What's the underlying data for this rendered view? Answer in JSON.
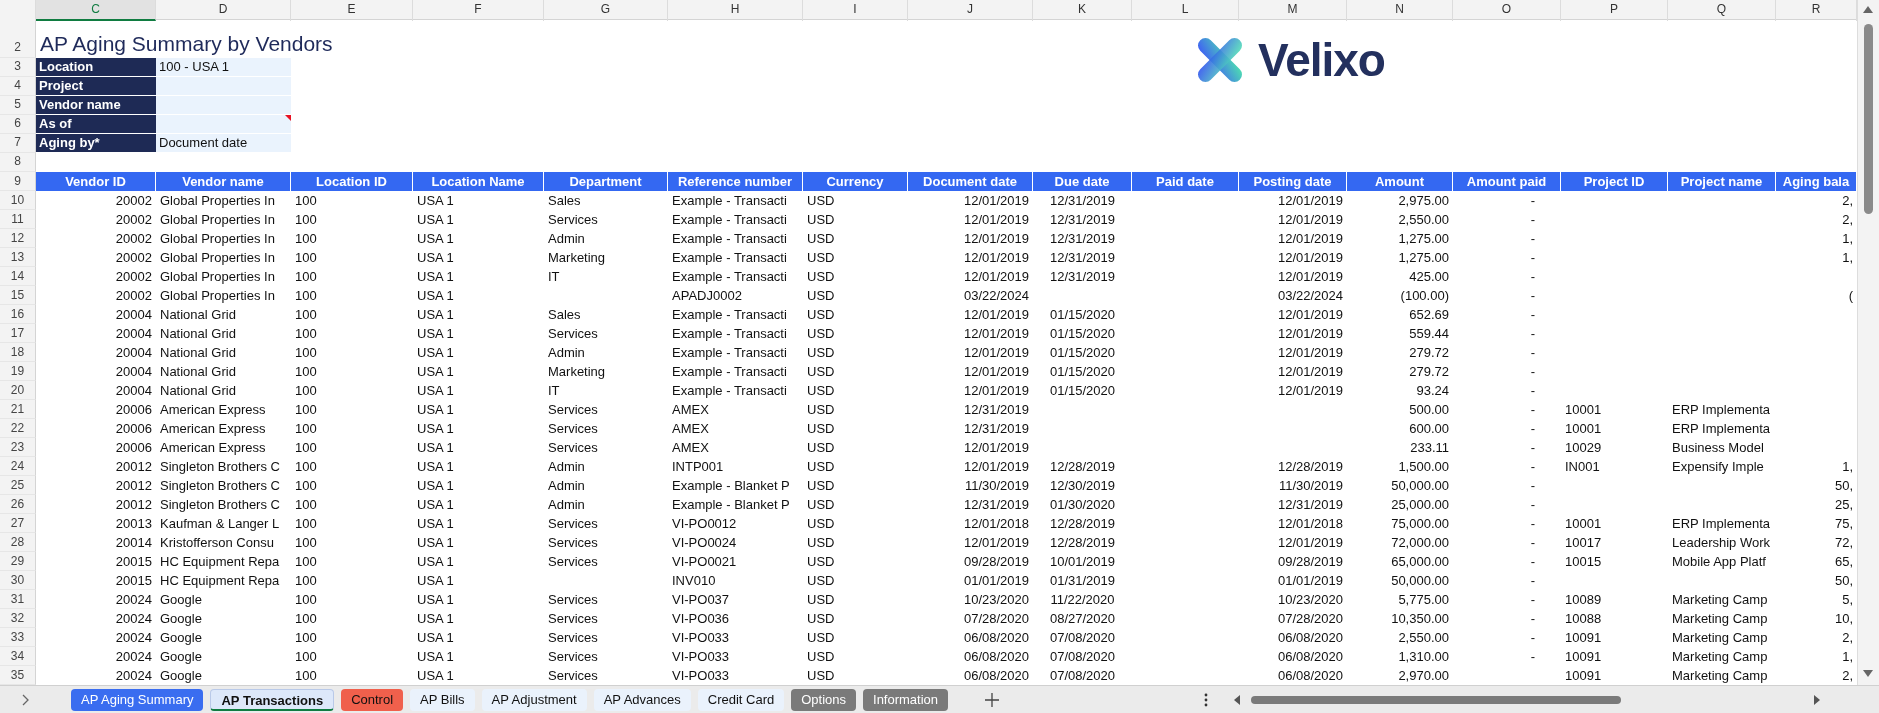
{
  "column_letters": [
    {
      "label": "C",
      "selected": true
    },
    {
      "label": "D",
      "selected": false
    },
    {
      "label": "E",
      "selected": false
    },
    {
      "label": "F",
      "selected": false
    },
    {
      "label": "G",
      "selected": false
    },
    {
      "label": "H",
      "selected": false
    },
    {
      "label": "I",
      "selected": false
    },
    {
      "label": "J",
      "selected": false
    },
    {
      "label": "K",
      "selected": false
    },
    {
      "label": "L",
      "selected": false
    },
    {
      "label": "M",
      "selected": false
    },
    {
      "label": "N",
      "selected": false
    },
    {
      "label": "O",
      "selected": false
    },
    {
      "label": "P",
      "selected": false
    },
    {
      "label": "Q",
      "selected": false
    },
    {
      "label": "R",
      "selected": false
    }
  ],
  "top_row_numbers": [
    "2",
    "3",
    "4",
    "5",
    "6",
    "7",
    "8"
  ],
  "title": "AP Aging Summary by Vendors",
  "parameters": [
    {
      "label": "Location",
      "value": "100 - USA 1",
      "comment": false
    },
    {
      "label": "Project",
      "comment": false
    },
    {
      "label": "Vendor name",
      "comment": false
    },
    {
      "label": "As of",
      "comment": true
    },
    {
      "label": "Aging by*",
      "value": "Document date",
      "comment": false
    }
  ],
  "logo": {
    "text": "Velixo"
  },
  "table": {
    "header_row_number": "9",
    "columns": [
      "Vendor ID",
      "Vendor name",
      "Location ID",
      "Location Name",
      "Department",
      "Reference number",
      "Currency",
      "Document date",
      "Due date",
      "Paid date",
      "Posting date",
      "Amount",
      "Amount paid",
      "Project ID",
      "Project name",
      "Aging bala"
    ],
    "rows": [
      {
        "number": "10",
        "cells": [
          "20002",
          "Global Properties In",
          "100",
          "USA 1",
          "Sales",
          "Example - Transacti",
          "USD",
          "12/01/2019",
          "12/31/2019",
          null,
          "12/01/2019",
          "2,975.00",
          "-",
          null,
          null,
          "2,"
        ]
      },
      {
        "number": "11",
        "cells": [
          "20002",
          "Global Properties In",
          "100",
          "USA 1",
          "Services",
          "Example - Transacti",
          "USD",
          "12/01/2019",
          "12/31/2019",
          null,
          "12/01/2019",
          "2,550.00",
          "-",
          null,
          null,
          "2,"
        ]
      },
      {
        "number": "12",
        "cells": [
          "20002",
          "Global Properties In",
          "100",
          "USA 1",
          "Admin",
          "Example - Transacti",
          "USD",
          "12/01/2019",
          "12/31/2019",
          null,
          "12/01/2019",
          "1,275.00",
          "-",
          null,
          null,
          "1,"
        ]
      },
      {
        "number": "13",
        "cells": [
          "20002",
          "Global Properties In",
          "100",
          "USA 1",
          "Marketing",
          "Example - Transacti",
          "USD",
          "12/01/2019",
          "12/31/2019",
          null,
          "12/01/2019",
          "1,275.00",
          "-",
          null,
          null,
          "1,"
        ]
      },
      {
        "number": "14",
        "cells": [
          "20002",
          "Global Properties In",
          "100",
          "USA 1",
          "IT",
          "Example - Transacti",
          "USD",
          "12/01/2019",
          "12/31/2019",
          null,
          "12/01/2019",
          "425.00",
          "-",
          null,
          null,
          null
        ]
      },
      {
        "number": "15",
        "cells": [
          "20002",
          "Global Properties In",
          "100",
          "USA 1",
          null,
          "APADJ0002",
          "USD",
          "03/22/2024",
          null,
          null,
          "03/22/2024",
          "(100.00)",
          "-",
          null,
          null,
          "("
        ]
      },
      {
        "number": "16",
        "cells": [
          "20004",
          "National Grid",
          "100",
          "USA 1",
          "Sales",
          "Example - Transacti",
          "USD",
          "12/01/2019",
          "01/15/2020",
          null,
          "12/01/2019",
          "652.69",
          "-",
          null,
          null,
          null
        ]
      },
      {
        "number": "17",
        "cells": [
          "20004",
          "National Grid",
          "100",
          "USA 1",
          "Services",
          "Example - Transacti",
          "USD",
          "12/01/2019",
          "01/15/2020",
          null,
          "12/01/2019",
          "559.44",
          "-",
          null,
          null,
          null
        ]
      },
      {
        "number": "18",
        "cells": [
          "20004",
          "National Grid",
          "100",
          "USA 1",
          "Admin",
          "Example - Transacti",
          "USD",
          "12/01/2019",
          "01/15/2020",
          null,
          "12/01/2019",
          "279.72",
          "-",
          null,
          null,
          null
        ]
      },
      {
        "number": "19",
        "cells": [
          "20004",
          "National Grid",
          "100",
          "USA 1",
          "Marketing",
          "Example - Transacti",
          "USD",
          "12/01/2019",
          "01/15/2020",
          null,
          "12/01/2019",
          "279.72",
          "-",
          null,
          null,
          null
        ]
      },
      {
        "number": "20",
        "cells": [
          "20004",
          "National Grid",
          "100",
          "USA 1",
          "IT",
          "Example - Transacti",
          "USD",
          "12/01/2019",
          "01/15/2020",
          null,
          "12/01/2019",
          "93.24",
          "-",
          null,
          null,
          null
        ]
      },
      {
        "number": "21",
        "cells": [
          "20006",
          "American Express",
          "100",
          "USA 1",
          "Services",
          "AMEX",
          "USD",
          "12/31/2019",
          null,
          null,
          null,
          "500.00",
          "-",
          "10001",
          "ERP Implementa",
          null
        ]
      },
      {
        "number": "22",
        "cells": [
          "20006",
          "American Express",
          "100",
          "USA 1",
          "Services",
          "AMEX",
          "USD",
          "12/31/2019",
          null,
          null,
          null,
          "600.00",
          "-",
          "10001",
          "ERP Implementa",
          null
        ]
      },
      {
        "number": "23",
        "cells": [
          "20006",
          "American Express",
          "100",
          "USA 1",
          "Services",
          "AMEX",
          "USD",
          "12/01/2019",
          null,
          null,
          null,
          "233.11",
          "-",
          "10029",
          "Business Model",
          null
        ]
      },
      {
        "number": "24",
        "cells": [
          "20012",
          "Singleton Brothers C",
          "100",
          "USA 1",
          "Admin",
          "INTP001",
          "USD",
          "12/01/2019",
          "12/28/2019",
          null,
          "12/28/2019",
          "1,500.00",
          "-",
          "IN001",
          "Expensify Imple",
          "1,"
        ]
      },
      {
        "number": "25",
        "cells": [
          "20012",
          "Singleton Brothers C",
          "100",
          "USA 1",
          "Admin",
          "Example - Blanket P",
          "USD",
          "11/30/2019",
          "12/30/2019",
          null,
          "11/30/2019",
          "50,000.00",
          "-",
          null,
          null,
          "50,"
        ]
      },
      {
        "number": "26",
        "cells": [
          "20012",
          "Singleton Brothers C",
          "100",
          "USA 1",
          "Admin",
          "Example - Blanket P",
          "USD",
          "12/31/2019",
          "01/30/2020",
          null,
          "12/31/2019",
          "25,000.00",
          "-",
          null,
          null,
          "25,"
        ]
      },
      {
        "number": "27",
        "cells": [
          "20013",
          "Kaufman & Langer L",
          "100",
          "USA 1",
          "Services",
          "VI-PO0012",
          "USD",
          "12/01/2018",
          "12/28/2019",
          null,
          "12/01/2018",
          "75,000.00",
          "-",
          "10001",
          "ERP Implementa",
          "75,"
        ]
      },
      {
        "number": "28",
        "cells": [
          "20014",
          "Kristofferson Consu",
          "100",
          "USA 1",
          "Services",
          "VI-PO0024",
          "USD",
          "12/01/2019",
          "12/28/2019",
          null,
          "12/01/2019",
          "72,000.00",
          "-",
          "10017",
          "Leadership Work",
          "72,"
        ]
      },
      {
        "number": "29",
        "cells": [
          "20015",
          "HC Equipment Repa",
          "100",
          "USA 1",
          "Services",
          "VI-PO0021",
          "USD",
          "09/28/2019",
          "10/01/2019",
          null,
          "09/28/2019",
          "65,000.00",
          "-",
          "10015",
          "Mobile App Platf",
          "65,"
        ]
      },
      {
        "number": "30",
        "cells": [
          "20015",
          "HC Equipment Repa",
          "100",
          "USA 1",
          null,
          "INV010",
          "USD",
          "01/01/2019",
          "01/31/2019",
          null,
          "01/01/2019",
          "50,000.00",
          "-",
          null,
          null,
          "50,"
        ]
      },
      {
        "number": "31",
        "cells": [
          "20024",
          "Google",
          "100",
          "USA 1",
          "Services",
          "VI-PO037",
          "USD",
          "10/23/2020",
          "11/22/2020",
          null,
          "10/23/2020",
          "5,775.00",
          "-",
          "10089",
          "Marketing Camp",
          "5,"
        ]
      },
      {
        "number": "32",
        "cells": [
          "20024",
          "Google",
          "100",
          "USA 1",
          "Services",
          "VI-PO036",
          "USD",
          "07/28/2020",
          "08/27/2020",
          null,
          "07/28/2020",
          "10,350.00",
          "-",
          "10088",
          "Marketing Camp",
          "10,"
        ]
      },
      {
        "number": "33",
        "cells": [
          "20024",
          "Google",
          "100",
          "USA 1",
          "Services",
          "VI-PO033",
          "USD",
          "06/08/2020",
          "07/08/2020",
          null,
          "06/08/2020",
          "2,550.00",
          "-",
          "10091",
          "Marketing Camp",
          "2,"
        ]
      },
      {
        "number": "34",
        "cells": [
          "20024",
          "Google",
          "100",
          "USA 1",
          "Services",
          "VI-PO033",
          "USD",
          "06/08/2020",
          "07/08/2020",
          null,
          "06/08/2020",
          "1,310.00",
          "-",
          "10091",
          "Marketing Camp",
          "1,"
        ]
      },
      {
        "number": "35",
        "cells": [
          "20024",
          "Google",
          "100",
          "USA 1",
          "Services",
          "VI-PO033",
          "USD",
          "06/08/2020",
          "07/08/2020",
          null,
          "06/08/2020",
          "2,970.00",
          null,
          "10091",
          "Marketing Camp",
          "2,"
        ]
      }
    ]
  },
  "tabs": [
    {
      "label": "AP Aging Summary",
      "color": "#3a6df0",
      "selected": false
    },
    {
      "label": "AP Transactions",
      "color": "#dde8fa",
      "selected": true
    },
    {
      "label": "Control",
      "color": "#f0604c",
      "selected": false
    },
    {
      "label": "AP Bills",
      "color": "#eaf2fc",
      "selected": false
    },
    {
      "label": "AP Adjustment",
      "color": "#eaf2fc",
      "selected": false
    },
    {
      "label": "AP Advances",
      "color": "#eaf2fc",
      "selected": false
    },
    {
      "label": "Credit Card",
      "color": "#eaf2fc",
      "selected": false
    },
    {
      "label": "Options",
      "color": "#7a7a7a",
      "selected": false
    },
    {
      "label": "Information",
      "color": "#7a7a7a",
      "selected": false
    }
  ]
}
